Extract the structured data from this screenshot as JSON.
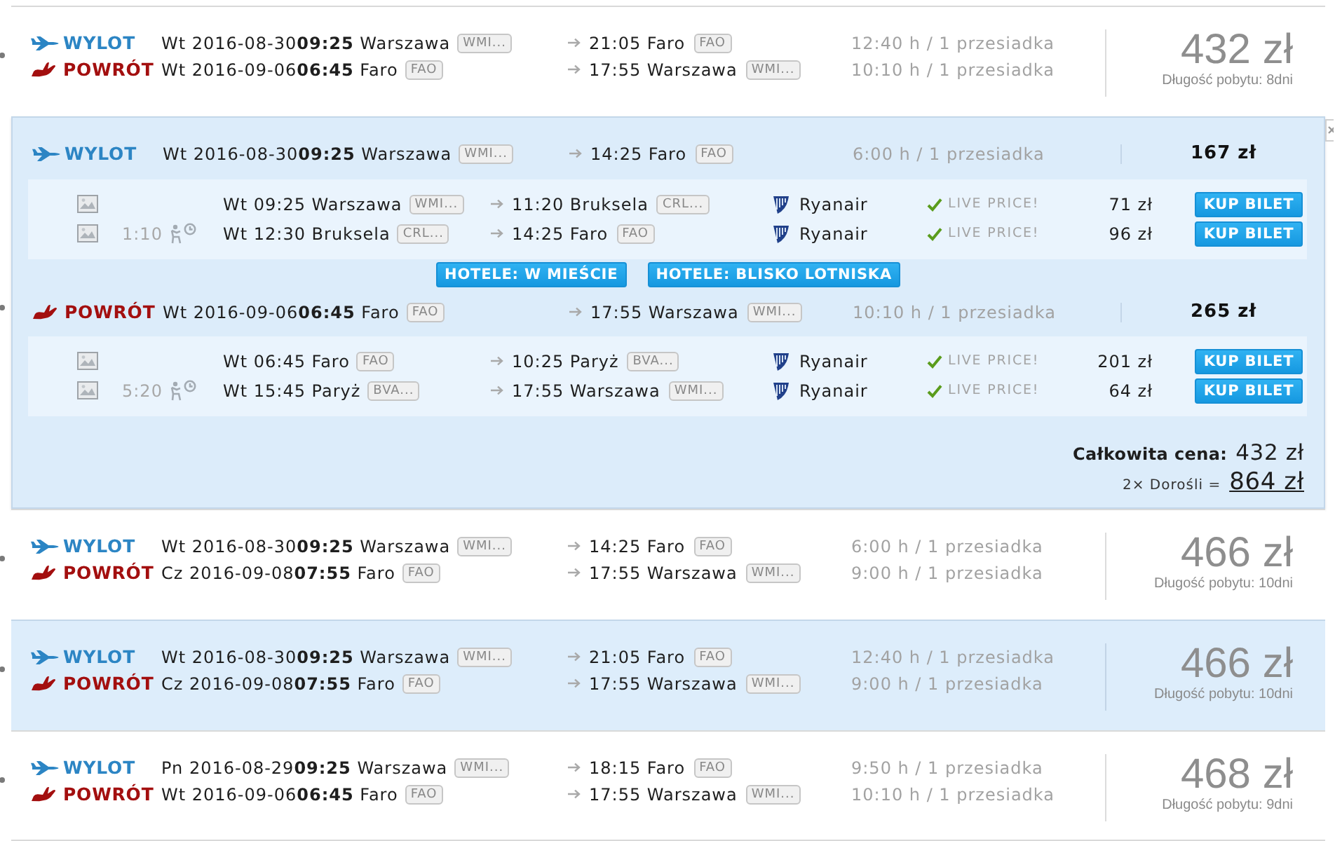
{
  "results": [
    {
      "expanded": false,
      "highlighted": false,
      "legs": [
        {
          "kind": "outbound",
          "label": "WYLOT",
          "departure": "Wt 2016-08-30**09:25** Warszawa",
          "departure_airport": "WMI...",
          "arrival": "21:05 Faro",
          "arrival_airport": "FAO",
          "duration": "12:40 h / 1 przesiadka"
        },
        {
          "kind": "return",
          "label": "POWRÓT",
          "departure": "Wt 2016-09-06**06:45** Faro",
          "departure_airport": "FAO",
          "arrival": "17:55 Warszawa",
          "arrival_airport": "WMI...",
          "duration": "10:10 h / 1 przesiadka"
        }
      ],
      "price": "432 zł",
      "stay": "Długość pobytu: 8dni"
    },
    {
      "expanded": true,
      "highlighted": false,
      "legs": [
        {
          "kind": "outbound",
          "label": "WYLOT",
          "departure": "Wt 2016-08-30**09:25** Warszawa",
          "departure_airport": "WMI...",
          "arrival": "14:25 Faro",
          "arrival_airport": "FAO",
          "duration": "6:00 h / 1 przesiadka",
          "leg_price": "167 zł",
          "segments": [
            {
              "departure": "Wt 09:25 Warszawa",
              "departure_airport": "WMI...",
              "arrival": "11:20 Bruksela",
              "arrival_airport": "CRL...",
              "airline": "Ryanair",
              "status": "LIVE PRICE!",
              "price": "71 zł",
              "button": "KUP BILET"
            },
            {
              "layover": "1:10",
              "departure": "Wt 12:30 Bruksela",
              "departure_airport": "CRL...",
              "arrival": "14:25 Faro",
              "arrival_airport": "FAO",
              "airline": "Ryanair",
              "status": "LIVE PRICE!",
              "price": "96 zł",
              "button": "KUP BILET"
            }
          ]
        },
        {
          "kind": "return",
          "label": "POWRÓT",
          "departure": "Wt 2016-09-06**06:45** Faro",
          "departure_airport": "FAO",
          "arrival": "17:55 Warszawa",
          "arrival_airport": "WMI...",
          "duration": "10:10 h / 1 przesiadka",
          "leg_price": "265 zł",
          "segments": [
            {
              "departure": "Wt 06:45 Faro",
              "departure_airport": "FAO",
              "arrival": "10:25 Paryż",
              "arrival_airport": "BVA...",
              "airline": "Ryanair",
              "status": "LIVE PRICE!",
              "price": "201 zł",
              "button": "KUP BILET"
            },
            {
              "layover": "5:20",
              "departure": "Wt 15:45 Paryż",
              "departure_airport": "BVA...",
              "arrival": "17:55 Warszawa",
              "arrival_airport": "WMI...",
              "airline": "Ryanair",
              "status": "LIVE PRICE!",
              "price": "64 zł",
              "button": "KUP BILET"
            }
          ]
        }
      ],
      "hotel_buttons": [
        "HOTELE: W MIEŚCIE",
        "HOTELE: BLISKO LOTNISKA"
      ],
      "total": {
        "label": "Całkowita cena:",
        "price": "432 zł",
        "passengers": "2× Dorośli =",
        "sum": "864 zł"
      }
    },
    {
      "expanded": false,
      "highlighted": false,
      "legs": [
        {
          "kind": "outbound",
          "label": "WYLOT",
          "departure": "Wt 2016-08-30**09:25** Warszawa",
          "departure_airport": "WMI...",
          "arrival": "14:25 Faro",
          "arrival_airport": "FAO",
          "duration": "6:00 h / 1 przesiadka"
        },
        {
          "kind": "return",
          "label": "POWRÓT",
          "departure": "Cz 2016-09-08**07:55** Faro",
          "departure_airport": "FAO",
          "arrival": "17:55 Warszawa",
          "arrival_airport": "WMI...",
          "duration": "9:00 h / 1 przesiadka"
        }
      ],
      "price": "466 zł",
      "stay": "Długość pobytu: 10dni"
    },
    {
      "expanded": false,
      "highlighted": true,
      "legs": [
        {
          "kind": "outbound",
          "label": "WYLOT",
          "departure": "Wt 2016-08-30**09:25** Warszawa",
          "departure_airport": "WMI...",
          "arrival": "21:05 Faro",
          "arrival_airport": "FAO",
          "duration": "12:40 h / 1 przesiadka"
        },
        {
          "kind": "return",
          "label": "POWRÓT",
          "departure": "Cz 2016-09-08**07:55** Faro",
          "departure_airport": "FAO",
          "arrival": "17:55 Warszawa",
          "arrival_airport": "WMI...",
          "duration": "9:00 h / 1 przesiadka"
        }
      ],
      "price": "466 zł",
      "stay": "Długość pobytu: 10dni"
    },
    {
      "expanded": false,
      "highlighted": false,
      "legs": [
        {
          "kind": "outbound",
          "label": "WYLOT",
          "departure": "Pn 2016-08-29**09:25** Warszawa",
          "departure_airport": "WMI...",
          "arrival": "18:15 Faro",
          "arrival_airport": "FAO",
          "duration": "9:50 h / 1 przesiadka"
        },
        {
          "kind": "return",
          "label": "POWRÓT",
          "departure": "Wt 2016-09-06**06:45** Faro",
          "departure_airport": "FAO",
          "arrival": "17:55 Warszawa",
          "arrival_airport": "WMI...",
          "duration": "10:10 h / 1 przesiadka"
        }
      ],
      "price": "468 zł",
      "stay": "Długość pobytu: 9dni"
    }
  ]
}
